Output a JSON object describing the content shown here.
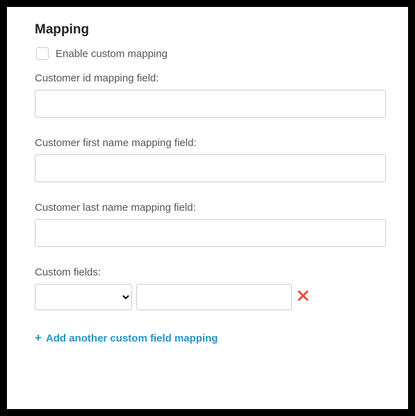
{
  "title": "Mapping",
  "enable": {
    "label": "Enable custom mapping",
    "checked": false
  },
  "fields": {
    "customer_id": {
      "label": "Customer id mapping field:",
      "value": ""
    },
    "first_name": {
      "label": "Customer first name mapping field:",
      "value": ""
    },
    "last_name": {
      "label": "Customer last name mapping field:",
      "value": ""
    }
  },
  "custom": {
    "label": "Custom fields:",
    "rows": [
      {
        "selected": "",
        "value": ""
      }
    ]
  },
  "add_link": "Add another custom field mapping"
}
